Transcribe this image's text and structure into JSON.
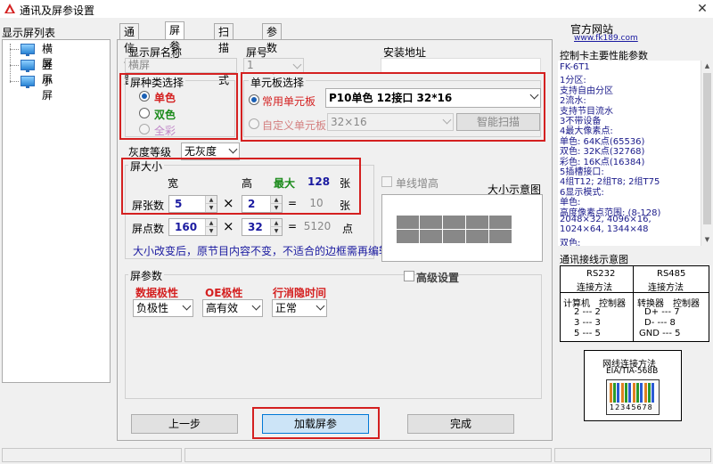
{
  "window": {
    "title": "通讯及屏参设置",
    "close_icon": "close-icon"
  },
  "left": {
    "list_label": "显示屏列表",
    "items": [
      {
        "label": "横屏"
      },
      {
        "label": "竖屏"
      },
      {
        "label": "小屏"
      }
    ]
  },
  "tabs": [
    {
      "label": "通信设置"
    },
    {
      "label": "屏参设置"
    },
    {
      "label": "扫描方式"
    },
    {
      "label": "参数回读"
    }
  ],
  "screen": {
    "name_label": "显示屏名称",
    "name_value": "横屏",
    "number_label": "屏号",
    "number_value": "1",
    "address_label": "安装地址",
    "address_value": ""
  },
  "screen_type": {
    "title": "屏种类选择",
    "options": [
      "单色",
      "双色",
      "全彩"
    ],
    "selected": "单色",
    "colors": [
      "#d42020",
      "#1a8a1a",
      "#c088c8"
    ]
  },
  "unit_board": {
    "title": "单元板选择",
    "common_label": "常用单元板",
    "common_value": "P10单色  12接口  32*16",
    "custom_label": "自定义单元板",
    "custom_value": "32×16",
    "smart_scan": "智能扫描"
  },
  "gray": {
    "label": "灰度等级",
    "value": "无灰度"
  },
  "screen_size": {
    "title": "屏大小",
    "width_header": "宽",
    "height_header": "高",
    "max_label": "最大",
    "max_value": "128",
    "max_unit": "张",
    "sheets_label": "屏张数",
    "sheets_w": "5",
    "sheets_h": "2",
    "sheets_total": "10",
    "sheets_unit": "张",
    "times": "×",
    "equals": "=",
    "points_label": "屏点数",
    "points_w": "160",
    "points_h": "32",
    "points_total": "5120",
    "points_unit": "点",
    "note": "大小改变后，原节目内容不变，不适合的边框需再编辑。"
  },
  "single_line": {
    "label": "单线增高",
    "preview_label": "大小示意图"
  },
  "params": {
    "title": "屏参数",
    "advanced": "高级设置",
    "data_polarity_label": "数据极性",
    "data_polarity_value": "负极性",
    "oe_polarity_label": "OE极性",
    "oe_polarity_value": "高有效",
    "blank_time_label": "行消隐时间",
    "blank_time_value": "正常"
  },
  "buttons": {
    "prev": "上一步",
    "load": "加载屏参",
    "finish": "完成"
  },
  "right": {
    "website_label": "官方网站",
    "website_url": "www.fk189.com",
    "info_title": "控制卡主要性能参数",
    "info_lines": [
      "FK-6T1",
      "1分区:",
      "  支持自由分区",
      "2流水:",
      "  支持节目流水",
      "3不带设备",
      "4最大像素点:",
      "  单色: 64K点(65536)",
      "  双色: 32K点(32768)",
      "  彩色: 16K点(16384)",
      "5插槽接口:",
      "  4组T12; 2组T8; 2组T75",
      "6显示模式:",
      "  单色:",
      "  高度像素点范围: (8-128)",
      "  2048×32, 4096×16,",
      "  1024×64, 1344×48",
      "  双色:"
    ],
    "wiring_title": "通讯接线示意图",
    "rs232": {
      "title": "RS232",
      "subtitle": "连接方法",
      "col1": "计算机",
      "col2": "控制器",
      "rows": [
        "2 --- 2",
        "3 --- 3",
        "5 --- 5"
      ]
    },
    "rs485": {
      "title": "RS485",
      "subtitle": "连接方法",
      "col1": "转换器",
      "col2": "控制器",
      "rows": [
        "D+ --- 7",
        "D- --- 8",
        "GND --- 5"
      ]
    },
    "rj45_title": "网线连接方法",
    "rj45_subtitle": "EIA/TIA-568B",
    "rj45_pins": "12345678"
  }
}
